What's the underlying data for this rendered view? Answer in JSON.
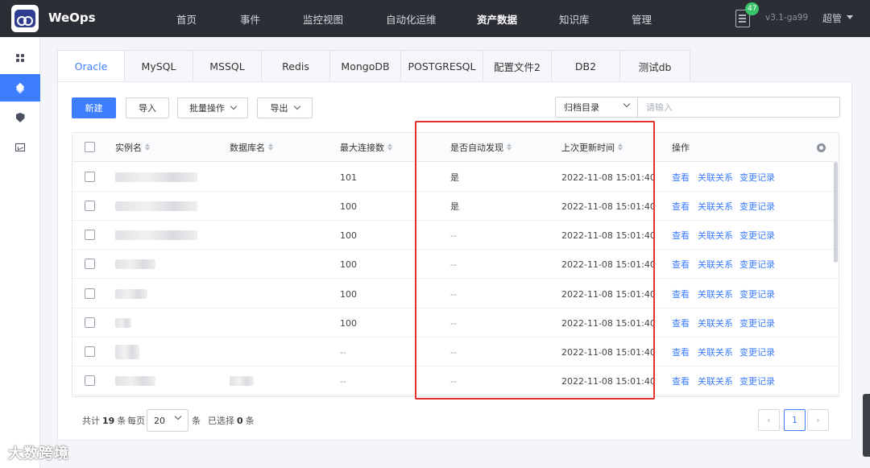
{
  "app": {
    "brand": "WeOps",
    "notification_count": "47",
    "version": "v3.1-ga99",
    "user": "超管"
  },
  "nav": [
    "首页",
    "事件",
    "监控视图",
    "自动化运维",
    "资产数据",
    "知识库",
    "管理"
  ],
  "tabs": [
    "Oracle",
    "MySQL",
    "MSSQL",
    "Redis",
    "MongoDB",
    "POSTGRESQL",
    "配置文件2",
    "DB2",
    "测试db"
  ],
  "toolbar": {
    "new": "新建",
    "import": "导入",
    "batch": "批量操作",
    "export": "导出",
    "filter_select": "归档目录",
    "search_placeholder": "请输入"
  },
  "table": {
    "headers": [
      "实例名",
      "数据库名",
      "最大连接数",
      "是否自动发现",
      "上次更新时间",
      "操作"
    ],
    "actions": [
      "查看",
      "关联关系",
      "变更记录"
    ],
    "rows": [
      {
        "max_conn": "101",
        "auto": "是",
        "updated": "2022-11-08 15:01:40"
      },
      {
        "max_conn": "100",
        "auto": "是",
        "updated": "2022-11-08 15:01:40"
      },
      {
        "max_conn": "100",
        "auto": "--",
        "updated": "2022-11-08 15:01:40"
      },
      {
        "max_conn": "100",
        "auto": "--",
        "updated": "2022-11-08 15:01:40"
      },
      {
        "max_conn": "100",
        "auto": "--",
        "updated": "2022-11-08 15:01:40"
      },
      {
        "max_conn": "100",
        "auto": "--",
        "updated": "2022-11-08 15:01:40"
      },
      {
        "max_conn": "--",
        "auto": "--",
        "updated": "2022-11-08 15:01:40"
      },
      {
        "max_conn": "--",
        "auto": "--",
        "updated": "2022-11-08 15:01:40"
      }
    ]
  },
  "pagination": {
    "total_prefix": "共计",
    "total": "19",
    "total_suffix": "条",
    "per_page_label": "每页",
    "per_page": "20",
    "per_page_suffix": "条",
    "selected_prefix": "已选择",
    "selected": "0",
    "selected_suffix": "条",
    "current_page": "1"
  },
  "watermark": "大数跨境"
}
